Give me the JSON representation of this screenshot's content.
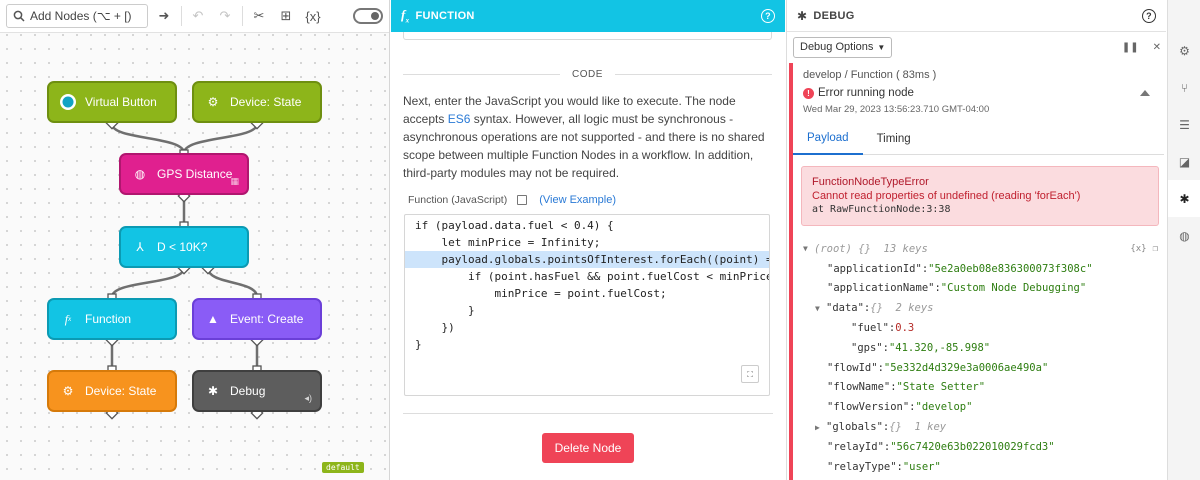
{
  "toolbar": {
    "add_nodes_label": "Add Nodes (⌥ + [)"
  },
  "canvas": {
    "nodes": {
      "virtual_button": "Virtual Button",
      "device_state_trigger": "Device: State",
      "gps_distance": "GPS Distance",
      "conditional": "D < 10K?",
      "function": "Function",
      "event_create": "Event: Create",
      "device_state_output": "Device: State",
      "debug": "Debug"
    },
    "default_badge": "default"
  },
  "function_panel": {
    "title": "FUNCTION",
    "section_label": "CODE",
    "description_pre": "Next, enter the JavaScript you would like to execute. The node accepts ",
    "description_link": "ES6",
    "description_post": " syntax. However, all logic must be synchronous - asynchronous operations are not supported - and there is no shared scope between multiple Function Nodes in a workflow. In addition, third-party modules may not be required.",
    "code_label": "Function (JavaScript)",
    "view_example": "(View Example)",
    "code_lines": [
      "if (payload.data.fuel < 0.4) {",
      "    let minPrice = Infinity;",
      "    payload.globals.pointsOfInterest.forEach((point) =>",
      "        if (point.hasFuel && point.fuelCost < minPrice",
      "            minPrice = point.fuelCost;",
      "        }",
      "    })",
      "}"
    ],
    "delete_label": "Delete Node"
  },
  "debug_panel": {
    "title": "DEBUG",
    "options_label": "Debug Options",
    "message_meta": "develop / Function ( 83ms )",
    "message_title": "Error running node",
    "message_time": "Wed Mar 29, 2023 13:56:23.710 GMT-04:00",
    "tabs": [
      "Payload",
      "Timing"
    ],
    "error": {
      "name": "FunctionNodeTypeError",
      "message": "Cannot read properties of undefined (reading 'forEach')",
      "stack": "at RawFunctionNode:3:38"
    },
    "json": {
      "root_label": "(root)",
      "root_meta": "{}  13 keys",
      "application_id_key": "\"applicationId\":",
      "application_id_val": "\"5e2a0eb08e836300073f308c\"",
      "application_name_key": "\"applicationName\":",
      "application_name_val": "\"Custom Node Debugging\"",
      "data_key": "\"data\":",
      "data_meta": "{}  2 keys",
      "fuel_key": "\"fuel\":",
      "fuel_val": "0.3",
      "gps_key": "\"gps\":",
      "gps_val": "\"41.320,-85.998\"",
      "flow_id_key": "\"flowId\":",
      "flow_id_val": "\"5e332d4d329e3a0006ae490a\"",
      "flow_name_key": "\"flowName\":",
      "flow_name_val": "\"State Setter\"",
      "flow_version_key": "\"flowVersion\":",
      "flow_version_val": "\"develop\"",
      "globals_key": "\"globals\":",
      "globals_meta": "{}  1 key",
      "relay_id_key": "\"relayId\":",
      "relay_id_val": "\"56c7420e63b022010029fcd3\"",
      "relay_type_key": "\"relayType\":",
      "relay_type_val": "\"user\""
    }
  },
  "colors": {
    "function_header": "#12c4e4",
    "error_red": "#ef4457",
    "link_blue": "#2a7ad6",
    "node_green": "#8db51a",
    "node_pink": "#e0208f",
    "node_purple": "#8a5cf6",
    "node_orange": "#f7931e",
    "node_gray": "#5d5d5d"
  },
  "icons": [
    "search-icon",
    "arrow-right-icon",
    "undo-icon",
    "redo-icon",
    "scissors-icon",
    "add-icon",
    "variables-icon",
    "toggle-icon",
    "help-icon",
    "bug-icon",
    "gear-icon",
    "branch-icon",
    "database-icon",
    "chart-icon",
    "globe-icon"
  ]
}
